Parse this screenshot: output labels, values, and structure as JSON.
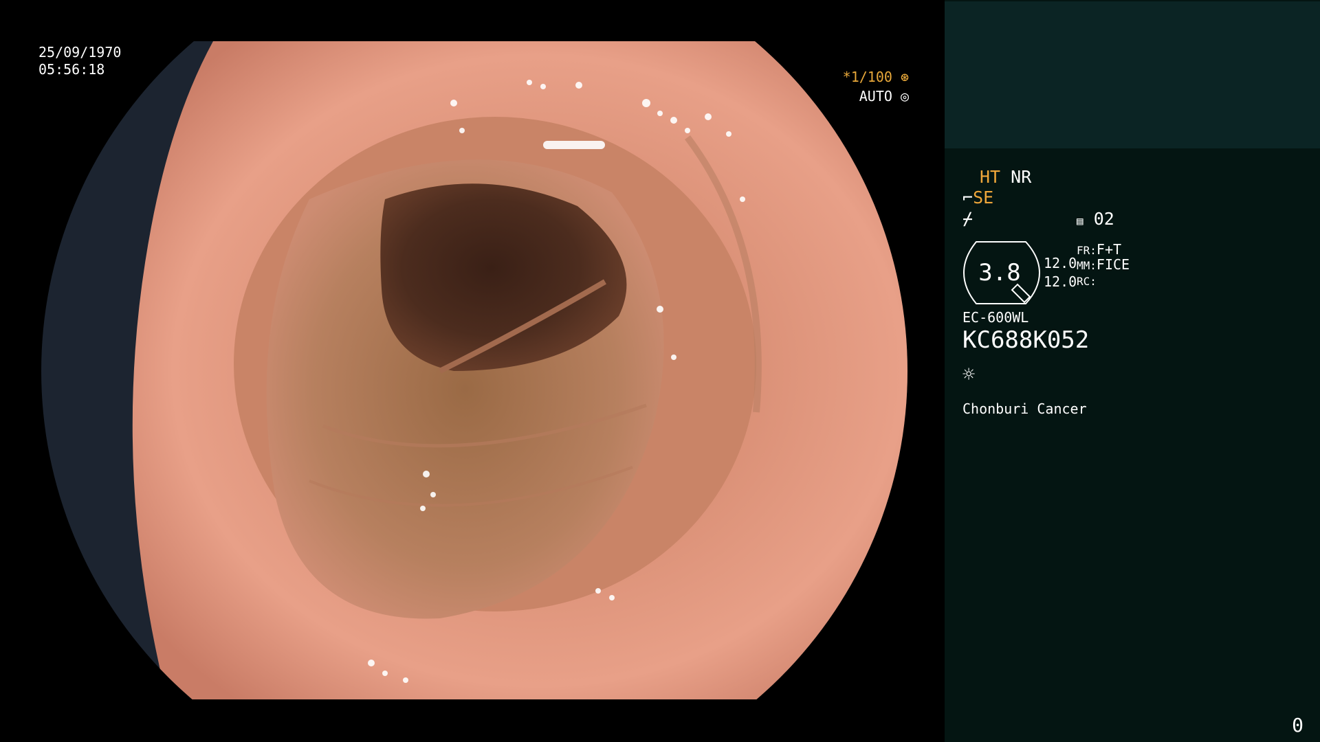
{
  "overlay": {
    "date": "25/09/1970",
    "time": "05:56:18",
    "shutter": "*1/100",
    "iris_mode": "AUTO"
  },
  "panel": {
    "ht_label": "HT",
    "nr_label": "NR",
    "se_label": "SE",
    "preset_number": "02",
    "zoom_value": "3.8",
    "value_a": "12.0",
    "value_b": "12.0",
    "fr_label": "FR:",
    "fr_value": "F+T",
    "mm_label": "MM:",
    "mm_value": "FICE",
    "rc_label": "RC:",
    "scope_model": "EC-600WL",
    "scope_serial": "KC688K052",
    "institution": "Chonburi Cancer",
    "counter": "0"
  },
  "colors": {
    "accent_orange": "#f0a73a",
    "panel_bg": "#041512",
    "panel_top_bg": "#0b2424"
  },
  "icons": [
    "shutter-icon",
    "iris-icon",
    "scope-hand-icon",
    "enhance-icon",
    "preset-icon",
    "light-icon"
  ]
}
